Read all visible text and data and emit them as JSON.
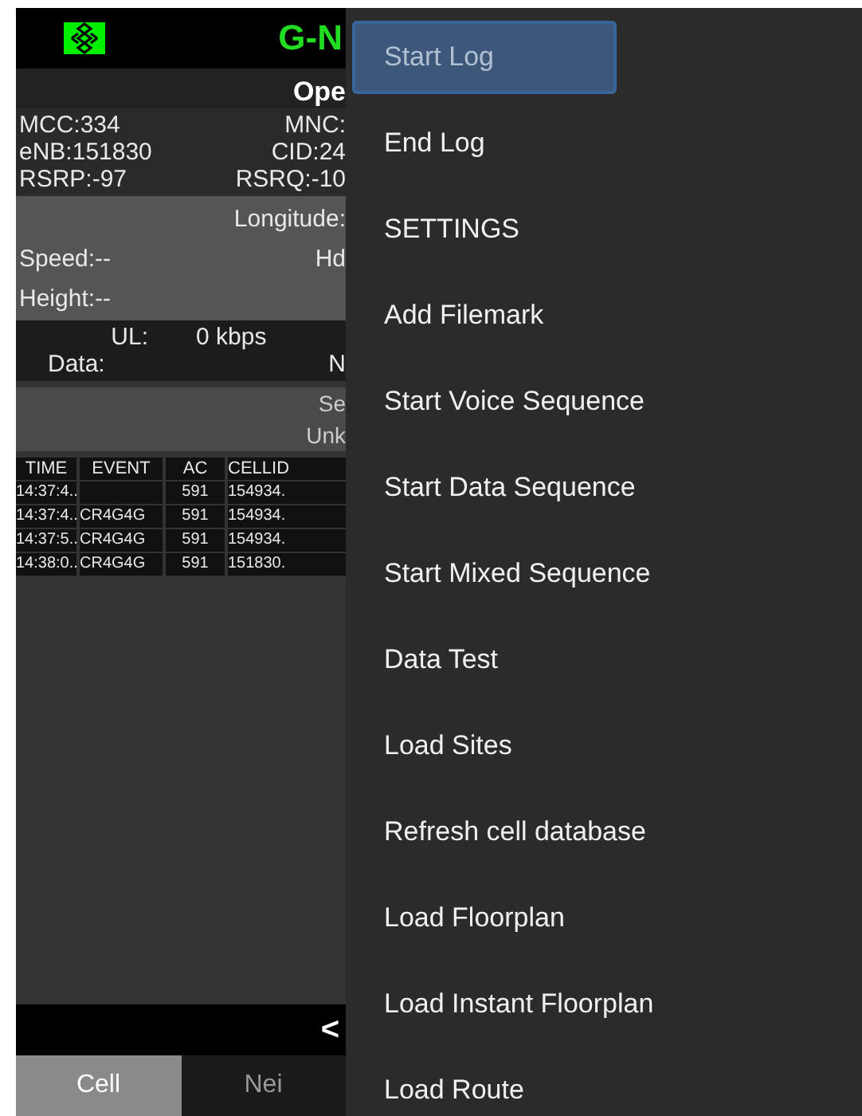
{
  "app": {
    "title": "G-N",
    "operator": "Ope",
    "info_rows": [
      [
        "MCC:334",
        "MNC:"
      ],
      [
        "eNB:151830",
        "CID:24"
      ],
      [
        "RSRP:-97",
        "RSRQ:-10"
      ]
    ],
    "gps": {
      "longitude": "Longitude:",
      "speed": "Speed:--",
      "heading": "Hd",
      "height": "Height:--"
    },
    "data": {
      "ul_label": "UL:",
      "ul_value": "0 kbps",
      "data_label": "Data:",
      "data_value": "N"
    },
    "service": {
      "line_1": "Se",
      "line_2": "Unk"
    },
    "table": {
      "columns": [
        "TIME",
        "EVENT",
        "AC",
        "CELLID"
      ],
      "rows": [
        [
          "14:37:4..",
          "",
          "591",
          "154934."
        ],
        [
          "14:37:4..",
          "CR4G4G",
          "591",
          "154934."
        ],
        [
          "14:37:5..",
          "CR4G4G",
          "591",
          "154934."
        ],
        [
          "14:38:0..",
          "CR4G4G",
          "591",
          "151830."
        ]
      ]
    },
    "nav_arrow": "<",
    "tabs": [
      {
        "label": "Cell",
        "selected": true
      },
      {
        "label": "Nei",
        "selected": false
      }
    ]
  },
  "menu": [
    {
      "label": "Start Log",
      "selected": true
    },
    {
      "label": "End Log",
      "selected": false
    },
    {
      "label": "SETTINGS",
      "selected": false
    },
    {
      "label": "Add Filemark",
      "selected": false
    },
    {
      "label": "Start Voice Sequence",
      "selected": false
    },
    {
      "label": "Start Data Sequence",
      "selected": false
    },
    {
      "label": "Start Mixed Sequence",
      "selected": false
    },
    {
      "label": "Data Test",
      "selected": false
    },
    {
      "label": "Load Sites",
      "selected": false
    },
    {
      "label": "Refresh cell database",
      "selected": false
    },
    {
      "label": "Load Floorplan",
      "selected": false
    },
    {
      "label": "Load Instant Floorplan",
      "selected": false
    },
    {
      "label": "Load Route",
      "selected": false
    }
  ]
}
